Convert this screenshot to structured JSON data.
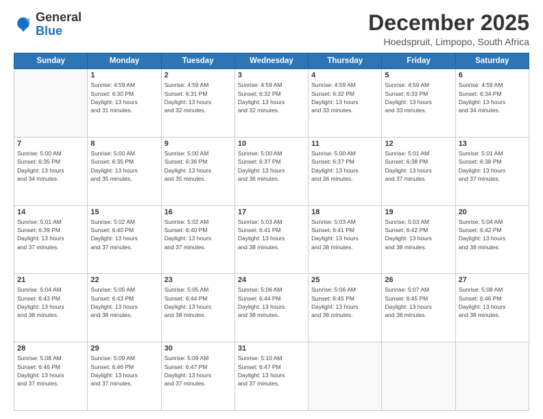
{
  "logo": {
    "general": "General",
    "blue": "Blue"
  },
  "title": "December 2025",
  "location": "Hoedspruit, Limpopo, South Africa",
  "days_of_week": [
    "Sunday",
    "Monday",
    "Tuesday",
    "Wednesday",
    "Thursday",
    "Friday",
    "Saturday"
  ],
  "weeks": [
    [
      {
        "day": "",
        "info": ""
      },
      {
        "day": "1",
        "info": "Sunrise: 4:59 AM\nSunset: 6:30 PM\nDaylight: 13 hours\nand 31 minutes."
      },
      {
        "day": "2",
        "info": "Sunrise: 4:59 AM\nSunset: 6:31 PM\nDaylight: 13 hours\nand 32 minutes."
      },
      {
        "day": "3",
        "info": "Sunrise: 4:59 AM\nSunset: 6:32 PM\nDaylight: 13 hours\nand 32 minutes."
      },
      {
        "day": "4",
        "info": "Sunrise: 4:59 AM\nSunset: 6:32 PM\nDaylight: 13 hours\nand 33 minutes."
      },
      {
        "day": "5",
        "info": "Sunrise: 4:59 AM\nSunset: 6:33 PM\nDaylight: 13 hours\nand 33 minutes."
      },
      {
        "day": "6",
        "info": "Sunrise: 4:59 AM\nSunset: 6:34 PM\nDaylight: 13 hours\nand 34 minutes."
      }
    ],
    [
      {
        "day": "7",
        "info": "Sunrise: 5:00 AM\nSunset: 6:35 PM\nDaylight: 13 hours\nand 34 minutes."
      },
      {
        "day": "8",
        "info": "Sunrise: 5:00 AM\nSunset: 6:35 PM\nDaylight: 13 hours\nand 35 minutes."
      },
      {
        "day": "9",
        "info": "Sunrise: 5:00 AM\nSunset: 6:36 PM\nDaylight: 13 hours\nand 35 minutes."
      },
      {
        "day": "10",
        "info": "Sunrise: 5:00 AM\nSunset: 6:37 PM\nDaylight: 13 hours\nand 36 minutes."
      },
      {
        "day": "11",
        "info": "Sunrise: 5:00 AM\nSunset: 6:37 PM\nDaylight: 13 hours\nand 36 minutes."
      },
      {
        "day": "12",
        "info": "Sunrise: 5:01 AM\nSunset: 6:38 PM\nDaylight: 13 hours\nand 37 minutes."
      },
      {
        "day": "13",
        "info": "Sunrise: 5:01 AM\nSunset: 6:38 PM\nDaylight: 13 hours\nand 37 minutes."
      }
    ],
    [
      {
        "day": "14",
        "info": "Sunrise: 5:01 AM\nSunset: 6:39 PM\nDaylight: 13 hours\nand 37 minutes."
      },
      {
        "day": "15",
        "info": "Sunrise: 5:02 AM\nSunset: 6:40 PM\nDaylight: 13 hours\nand 37 minutes."
      },
      {
        "day": "16",
        "info": "Sunrise: 5:02 AM\nSunset: 6:40 PM\nDaylight: 13 hours\nand 37 minutes."
      },
      {
        "day": "17",
        "info": "Sunrise: 5:03 AM\nSunset: 6:41 PM\nDaylight: 13 hours\nand 38 minutes."
      },
      {
        "day": "18",
        "info": "Sunrise: 5:03 AM\nSunset: 6:41 PM\nDaylight: 13 hours\nand 38 minutes."
      },
      {
        "day": "19",
        "info": "Sunrise: 5:03 AM\nSunset: 6:42 PM\nDaylight: 13 hours\nand 38 minutes."
      },
      {
        "day": "20",
        "info": "Sunrise: 5:04 AM\nSunset: 6:42 PM\nDaylight: 13 hours\nand 38 minutes."
      }
    ],
    [
      {
        "day": "21",
        "info": "Sunrise: 5:04 AM\nSunset: 6:43 PM\nDaylight: 13 hours\nand 38 minutes."
      },
      {
        "day": "22",
        "info": "Sunrise: 5:05 AM\nSunset: 6:43 PM\nDaylight: 13 hours\nand 38 minutes."
      },
      {
        "day": "23",
        "info": "Sunrise: 5:05 AM\nSunset: 6:44 PM\nDaylight: 13 hours\nand 38 minutes."
      },
      {
        "day": "24",
        "info": "Sunrise: 5:06 AM\nSunset: 6:44 PM\nDaylight: 13 hours\nand 38 minutes."
      },
      {
        "day": "25",
        "info": "Sunrise: 5:06 AM\nSunset: 6:45 PM\nDaylight: 13 hours\nand 38 minutes."
      },
      {
        "day": "26",
        "info": "Sunrise: 5:07 AM\nSunset: 6:45 PM\nDaylight: 13 hours\nand 38 minutes."
      },
      {
        "day": "27",
        "info": "Sunrise: 5:08 AM\nSunset: 6:46 PM\nDaylight: 13 hours\nand 38 minutes."
      }
    ],
    [
      {
        "day": "28",
        "info": "Sunrise: 5:08 AM\nSunset: 6:46 PM\nDaylight: 13 hours\nand 37 minutes."
      },
      {
        "day": "29",
        "info": "Sunrise: 5:09 AM\nSunset: 6:46 PM\nDaylight: 13 hours\nand 37 minutes."
      },
      {
        "day": "30",
        "info": "Sunrise: 5:09 AM\nSunset: 6:47 PM\nDaylight: 13 hours\nand 37 minutes."
      },
      {
        "day": "31",
        "info": "Sunrise: 5:10 AM\nSunset: 6:47 PM\nDaylight: 13 hours\nand 37 minutes."
      },
      {
        "day": "",
        "info": ""
      },
      {
        "day": "",
        "info": ""
      },
      {
        "day": "",
        "info": ""
      }
    ]
  ]
}
